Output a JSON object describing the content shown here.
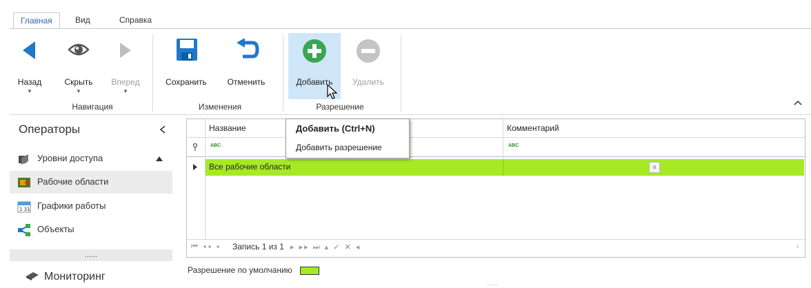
{
  "ribbon": {
    "tabs": [
      "Главная",
      "Вид",
      "Справка"
    ],
    "buttons": {
      "back": "Назад",
      "hide": "Скрыть",
      "forward": "Вперед",
      "save": "Сохранить",
      "cancel": "Отменить",
      "add": "Добавить",
      "delete": "Удалить"
    },
    "groups": {
      "navigation": "Навигация",
      "changes": "Изменения",
      "permission": "Разрешение"
    }
  },
  "sidebar": {
    "title": "Операторы",
    "items": [
      {
        "label": "Уровни доступа",
        "icon": "access-levels-icon"
      },
      {
        "label": "Рабочие области",
        "icon": "workspaces-icon"
      },
      {
        "label": "Графики работы",
        "icon": "schedule-icon"
      },
      {
        "label": "Объекты",
        "icon": "objects-icon"
      }
    ],
    "more": "......",
    "monitoring": "Мониторинг"
  },
  "grid": {
    "columns": [
      "Название",
      "Комментарий"
    ],
    "filter_icon_text": "ABC",
    "rows": [
      {
        "name": "Все рабочие области",
        "comment": ""
      }
    ],
    "navigator": "Запись 1 из 1"
  },
  "tooltip": {
    "title": "Добавить (Ctrl+N)",
    "text": "Добавить разрешение"
  },
  "legend": {
    "label": "Разрешение по умолчанию",
    "color": "#a6ea26"
  },
  "colors": {
    "accent": "#2b6cb0",
    "add_green": "#3aa655",
    "icon_blue": "#1f78c8",
    "selected_row": "#a6ea26",
    "hover_bg": "#cfe6f8"
  }
}
